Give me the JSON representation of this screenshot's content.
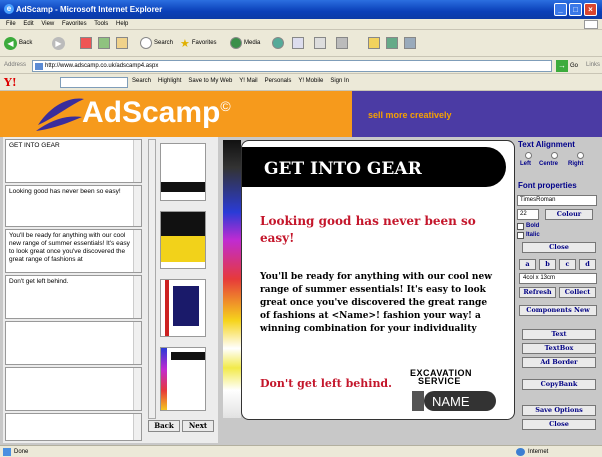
{
  "window": {
    "title": "AdScamp - Microsoft Internet Explorer"
  },
  "menu": [
    "File",
    "Edit",
    "View",
    "Favorites",
    "Tools",
    "Help"
  ],
  "toolbar": {
    "back": "Back",
    "search": "Search",
    "favorites": "Favorites",
    "media": "Media"
  },
  "address": {
    "label": "Address",
    "url": "http://www.adscamp.co.uk/adscamp4.aspx",
    "go": "Go",
    "links": "Links"
  },
  "yahoo": {
    "logo": "Y!",
    "items": [
      "Search",
      "Highlight",
      "Save to My Web",
      "Y! Mail",
      "Personals",
      "Y! Mobile",
      "Sign In"
    ]
  },
  "banner": {
    "logo": "AdScamp",
    "mark": "©",
    "tagline": "sell more creatively"
  },
  "editor": {
    "fields": [
      "GET INTO GEAR",
      "Looking good has never been so easy!",
      "You'll be ready for anything with our cool new range of summer essentials! It's easy to look great once you've discovered the great range of fashions at",
      "Don't get left behind."
    ],
    "back": "Back",
    "next": "Next"
  },
  "ad": {
    "headline": "GET INTO GEAR",
    "subhead": "Looking good has never been so easy!",
    "body": "You'll be ready for anything with our cool new range of summer essentials! It's easy to look great once you've discovered the great range of fashions at <Name>! fashion your way! a winning combination for your individuality",
    "footer": "Don't get left behind.",
    "logo_line1": "EXCAVATION",
    "logo_line2": "SERVICE",
    "logo_name": "NAME"
  },
  "panel": {
    "align_title": "Text Alignment",
    "align_options": [
      "Left",
      "Centre",
      "Right"
    ],
    "font_title": "Font properties",
    "font_value": "TimesRoman",
    "size_value": "22",
    "colour": "Colour",
    "bold": "Bold",
    "italic": "Italic",
    "close": "Close",
    "size_buttons": [
      "a",
      "b",
      "c",
      "d"
    ],
    "dimension": "4col x 13cm",
    "refresh": "Refresh",
    "collect": "Collect",
    "components": "Components New",
    "text": "Text",
    "textbox": "TextBox",
    "border": "Ad Border",
    "copybank": "CopyBank",
    "save": "Save Options",
    "close2": "Close"
  },
  "status": {
    "left": "Done",
    "right": "Internet"
  }
}
